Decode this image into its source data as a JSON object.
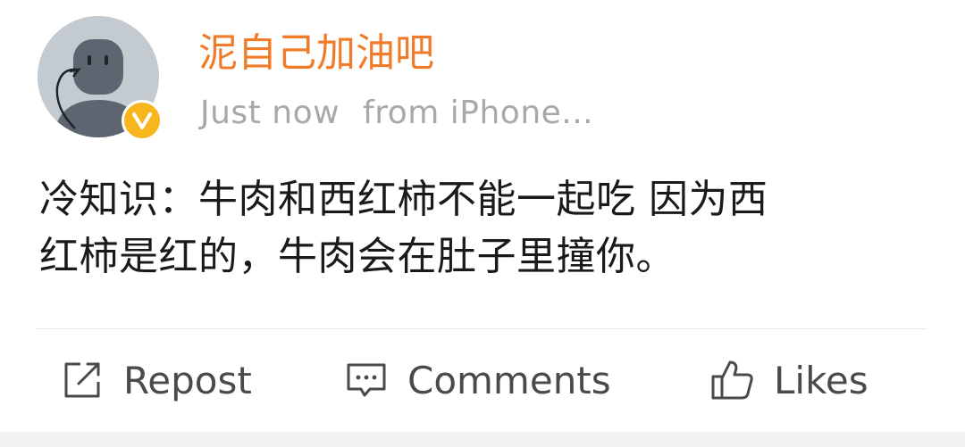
{
  "post": {
    "username": "泥自己加油吧",
    "timestamp": "Just now",
    "source": "from iPhone...",
    "text_line1": "冷知识：牛肉和西红柿不能一起吃 因为西",
    "text_line2": "红柿是红的，牛肉会在肚子里撞你。",
    "verified": true
  },
  "actions": {
    "repost_label": "Repost",
    "comments_label": "Comments",
    "likes_label": "Likes"
  },
  "icons": {
    "verified": "verified-v-badge-icon",
    "repost": "repost-icon",
    "comments": "comment-bubble-icon",
    "likes": "thumbs-up-icon"
  },
  "colors": {
    "username": "#f07c2b",
    "verified_badge": "#f7b51e",
    "meta_text": "#a8a8a8",
    "body_text": "#1a1a1a",
    "action_text": "#4a4a4a"
  }
}
